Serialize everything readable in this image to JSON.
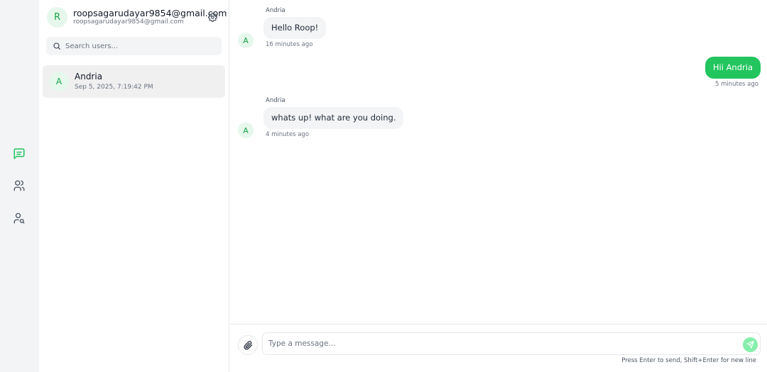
{
  "rail": {
    "items": [
      {
        "name": "chats",
        "icon": "message-square-icon",
        "active": true
      },
      {
        "name": "contacts",
        "icon": "users-icon",
        "active": false
      },
      {
        "name": "find-user",
        "icon": "user-search-icon",
        "active": false
      }
    ],
    "accent": "#22c55e"
  },
  "sidebar": {
    "me": {
      "initial": "R",
      "name": "roopsagarudayar9854@gmail.com",
      "email": "roopsagarudayar9854@gmail.com"
    },
    "search": {
      "placeholder": "Search users..."
    },
    "contacts": [
      {
        "initial": "A",
        "name": "Andria",
        "time": "Sep 5, 2025, 7:19:42 PM"
      }
    ]
  },
  "chat": {
    "messages": [
      {
        "direction": "in",
        "sender": "Andria",
        "initial": "A",
        "text": "Hello Roop!",
        "time": "16 minutes ago"
      },
      {
        "direction": "out",
        "text": "Hii Andria",
        "time": "5 minutes ago"
      },
      {
        "direction": "in",
        "sender": "Andria",
        "initial": "A",
        "text": "whats up! what are you doing.",
        "time": "4 minutes ago"
      }
    ],
    "composer": {
      "placeholder": "Type a message...",
      "hint": "Press Enter to send, Shift+Enter for new line"
    }
  }
}
